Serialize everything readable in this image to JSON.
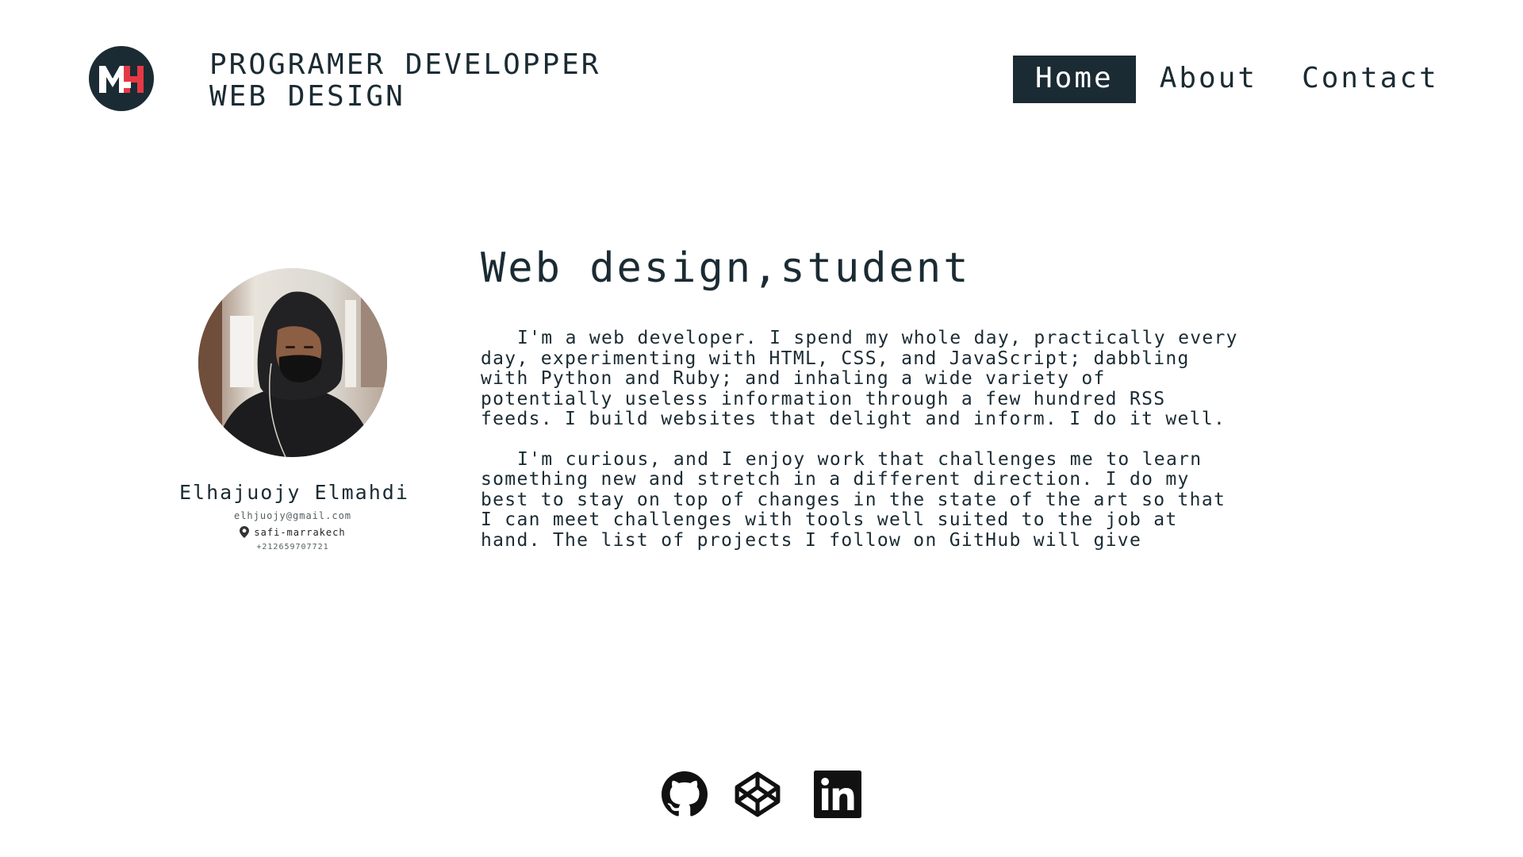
{
  "header": {
    "logo_text": "MH",
    "brand_line1": "PROGRAMER DEVELOPPER",
    "brand_line2": "WEB DESIGN",
    "nav": [
      {
        "label": "Home",
        "active": true
      },
      {
        "label": "About",
        "active": false
      },
      {
        "label": "Contact",
        "active": false
      }
    ]
  },
  "profile": {
    "name": "Elhajuojy Elmahdi",
    "email": "elhjuojy@gmail.com",
    "location": "safi-marrakech",
    "phone": "+212659707721"
  },
  "main": {
    "title": "Web design,student",
    "paragraphs": [
      "I'm a web developer. I spend my whole day, practically every day, experimenting with HTML, CSS, and JavaScript; dabbling with Python and Ruby; and inhaling a wide variety of potentially useless information through a few hundred RSS feeds. I build websites that delight and inform. I do it well.",
      "I'm curious, and I enjoy work that challenges me to learn something new and stretch in a different direction. I do my best to stay on top of changes in the state of the art so that I can meet challenges with tools well suited to the job at hand. The list of projects I follow on GitHub will give"
    ]
  },
  "social": [
    {
      "icon": "github-icon"
    },
    {
      "icon": "codepen-icon"
    },
    {
      "icon": "linkedin-icon"
    }
  ],
  "colors": {
    "primary": "#1b2b33",
    "accent": "#e63946",
    "background": "#ffffff"
  }
}
